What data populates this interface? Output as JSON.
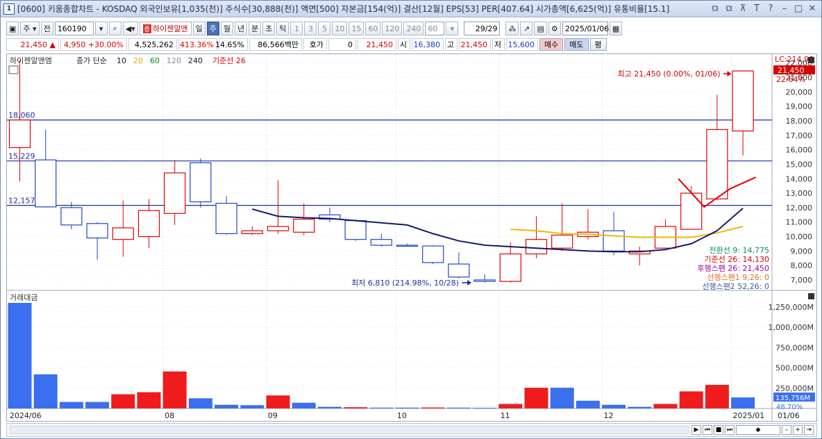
{
  "title": {
    "num": "1",
    "text": "[0600] 키움종합차트 - KOSDAQ 외국인보유[1,035(천)] 주식수[30,888(천)] 액면[500] 자본금[154(억)] 결산[12월] EPS[53] PER[407.64] 시가총액[6,625(억)] 유통비율[15.1]",
    "controls": [
      "⧉",
      "⧉",
      "⊼",
      "T",
      "?",
      "–",
      "□",
      "✕"
    ]
  },
  "toolbar": {
    "mode": "주",
    "mode2": "전",
    "code": "160190",
    "stock_name": "하이젠알앤",
    "periods": [
      "일",
      "주",
      "월",
      "년",
      "분",
      "초",
      "틱"
    ],
    "selected_period": "주",
    "numbers": [
      "1",
      "3",
      "5",
      "10",
      "15",
      "60",
      "120",
      "240",
      "60"
    ],
    "count": "29",
    "count_total": "/29",
    "date": "2025/01/06"
  },
  "quote": {
    "price": "21,450",
    "change": "4,950",
    "change_pct": "+30.00%",
    "volume": "4,525,262",
    "vol_ratio": "413.36%",
    "turnover_pct": "14.65%",
    "amount": "86,566백만",
    "hoga_label": "호가",
    "hoga_val": "0",
    "hoga_price": "21,450",
    "open_label": "시",
    "open": "16,380",
    "high_label": "고",
    "high": "21,450",
    "low_label": "저",
    "low": "15,600",
    "buy": "매수",
    "sell": "매도",
    "eval": "평"
  },
  "price_panel": {
    "stock_label": "하이젠알앤엠",
    "legend_prefix": "종가 단순",
    "ma": [
      {
        "label": "10",
        "color": "#1a1a1a"
      },
      {
        "label": "20",
        "color": "#e0a800"
      },
      {
        "label": "60",
        "color": "#0a8a0a"
      },
      {
        "label": "120",
        "color": "#888888"
      },
      {
        "label": "240",
        "color": "#1a1a1a"
      }
    ],
    "base_line_label": "기준선 26",
    "hlines": [
      {
        "label": "18,060",
        "value": 18060
      },
      {
        "label": "15,229",
        "value": 15229
      },
      {
        "label": "12,157",
        "value": 12157
      }
    ],
    "high_annot": "최고 21,450 (0.00%, 01/06)",
    "low_annot": "최저 6,810 (214.98%, 10/28)",
    "axis_top": "LC:214.98",
    "price_tag": "21,450",
    "pct_tag": "22.64%",
    "ichimoku": [
      {
        "label": "전환선 9: 14,775",
        "color": "#0a8a6a"
      },
      {
        "label": "기준선 26: 14,130",
        "color": "#d80000"
      },
      {
        "label": "후행스팬 26: 21,450",
        "color": "#a000a0"
      },
      {
        "label": "선행스팬1 9,26: 0",
        "color": "#e07020"
      },
      {
        "label": "선행스팬2 52,26: 0",
        "color": "#3a5aa0"
      }
    ]
  },
  "volume_panel": {
    "label": "거래대금",
    "axis": [
      "1,250,000M",
      "1,000,000M",
      "750,000M",
      "500,000M",
      "250,000M"
    ],
    "tag": "135,756M",
    "tag_pct": "48.70%"
  },
  "x_labels": [
    {
      "label": "2024/06",
      "i": 0
    },
    {
      "label": "08",
      "i": 6
    },
    {
      "label": "09",
      "i": 10
    },
    {
      "label": "10",
      "i": 15
    },
    {
      "label": "11",
      "i": 19
    },
    {
      "label": "12",
      "i": 23
    },
    {
      "label": "2025/01",
      "i": 28
    }
  ],
  "x_end_label": "01/06",
  "chart_data": {
    "type": "candlestick",
    "ylim": [
      6000,
      22500
    ],
    "yticks": [
      7000,
      8000,
      9000,
      10000,
      11000,
      12000,
      13000,
      14000,
      15000,
      16000,
      17000,
      18000,
      19000,
      20000,
      21000,
      22000
    ],
    "ytick_labels": [
      "7,000",
      "8,000",
      "9,000",
      "10,000",
      "11,000",
      "12,000",
      "13,000",
      "14,000",
      "15,000",
      "16,000",
      "17,000",
      "18,000",
      "19,000",
      "20,000",
      "21,000",
      "22,000"
    ],
    "candles": [
      {
        "o": 16150,
        "h": 22200,
        "l": 13800,
        "c": 18060
      },
      {
        "o": 15300,
        "h": 17400,
        "l": 12000,
        "c": 12050
      },
      {
        "o": 12000,
        "h": 12400,
        "l": 10500,
        "c": 10800
      },
      {
        "o": 10900,
        "h": 11000,
        "l": 8400,
        "c": 9900
      },
      {
        "o": 9800,
        "h": 12500,
        "l": 8600,
        "c": 10600
      },
      {
        "o": 10000,
        "h": 12600,
        "l": 9200,
        "c": 11800
      },
      {
        "o": 11600,
        "h": 15300,
        "l": 10800,
        "c": 14400
      },
      {
        "o": 15100,
        "h": 15400,
        "l": 12000,
        "c": 12400
      },
      {
        "o": 12300,
        "h": 12800,
        "l": 10100,
        "c": 10200
      },
      {
        "o": 10200,
        "h": 10700,
        "l": 10100,
        "c": 10400
      },
      {
        "o": 10400,
        "h": 13900,
        "l": 10200,
        "c": 10700
      },
      {
        "o": 10300,
        "h": 12300,
        "l": 10100,
        "c": 11200
      },
      {
        "o": 11500,
        "h": 12000,
        "l": 11000,
        "c": 11200
      },
      {
        "o": 11100,
        "h": 11200,
        "l": 9700,
        "c": 9800
      },
      {
        "o": 9800,
        "h": 10200,
        "l": 9300,
        "c": 9400
      },
      {
        "o": 9400,
        "h": 9500,
        "l": 9300,
        "c": 9350
      },
      {
        "o": 9350,
        "h": 9400,
        "l": 8100,
        "c": 8200
      },
      {
        "o": 8100,
        "h": 8900,
        "l": 7100,
        "c": 7200
      },
      {
        "o": 7000,
        "h": 7400,
        "l": 6810,
        "c": 6900
      },
      {
        "o": 6900,
        "h": 9600,
        "l": 6810,
        "c": 8800
      },
      {
        "o": 8800,
        "h": 11400,
        "l": 8500,
        "c": 9800
      },
      {
        "o": 9200,
        "h": 12300,
        "l": 9000,
        "c": 10100
      },
      {
        "o": 10000,
        "h": 11900,
        "l": 9800,
        "c": 10300
      },
      {
        "o": 10400,
        "h": 11700,
        "l": 8700,
        "c": 9000
      },
      {
        "o": 8800,
        "h": 9300,
        "l": 8000,
        "c": 9000
      },
      {
        "o": 9200,
        "h": 11200,
        "l": 9200,
        "c": 10700
      },
      {
        "o": 10500,
        "h": 13500,
        "l": 10500,
        "c": 13000
      },
      {
        "o": 12600,
        "h": 19800,
        "l": 12500,
        "c": 17400
      },
      {
        "o": 17300,
        "h": 21450,
        "l": 15600,
        "c": 21450
      }
    ],
    "ma10": [
      [
        9,
        11900
      ],
      [
        10,
        11400
      ],
      [
        11,
        11300
      ],
      [
        12,
        11250
      ],
      [
        13,
        11100
      ],
      [
        14,
        10950
      ],
      [
        15,
        10800
      ],
      [
        16,
        10200
      ],
      [
        17,
        9700
      ],
      [
        18,
        9400
      ],
      [
        19,
        9300
      ],
      [
        20,
        9200
      ],
      [
        21,
        9100
      ],
      [
        22,
        9000
      ],
      [
        23,
        8950
      ],
      [
        24,
        8950
      ],
      [
        25,
        9100
      ],
      [
        26,
        9500
      ],
      [
        27,
        10400
      ],
      [
        28,
        11950
      ]
    ],
    "ma20": [
      [
        19,
        10500
      ],
      [
        20,
        10400
      ],
      [
        21,
        10200
      ],
      [
        22,
        10150
      ],
      [
        23,
        10050
      ],
      [
        24,
        9950
      ],
      [
        25,
        9950
      ],
      [
        26,
        9950
      ],
      [
        27,
        10250
      ],
      [
        28,
        10700
      ]
    ],
    "kijun": [
      [
        25.5,
        14000
      ],
      [
        26.5,
        12050
      ],
      [
        27.5,
        13300
      ],
      [
        28.5,
        14100
      ]
    ],
    "volume": {
      "ylim": [
        0,
        1300000
      ],
      "bars": [
        {
          "v": 1300000,
          "up": false
        },
        {
          "v": 420000,
          "up": false
        },
        {
          "v": 80000,
          "up": false
        },
        {
          "v": 80000,
          "up": false
        },
        {
          "v": 175000,
          "up": true
        },
        {
          "v": 200000,
          "up": true
        },
        {
          "v": 455000,
          "up": true
        },
        {
          "v": 125000,
          "up": false
        },
        {
          "v": 45000,
          "up": false
        },
        {
          "v": 40000,
          "up": false
        },
        {
          "v": 160000,
          "up": true
        },
        {
          "v": 70000,
          "up": false
        },
        {
          "v": 20000,
          "up": false
        },
        {
          "v": 15000,
          "up": true
        },
        {
          "v": 10000,
          "up": false
        },
        {
          "v": 10000,
          "up": false
        },
        {
          "v": 12000,
          "up": true
        },
        {
          "v": 10000,
          "up": false
        },
        {
          "v": 8000,
          "up": false
        },
        {
          "v": 55000,
          "up": true
        },
        {
          "v": 255000,
          "up": true
        },
        {
          "v": 255000,
          "up": false
        },
        {
          "v": 95000,
          "up": false
        },
        {
          "v": 45000,
          "up": false
        },
        {
          "v": 20000,
          "up": false
        },
        {
          "v": 55000,
          "up": true
        },
        {
          "v": 210000,
          "up": true
        },
        {
          "v": 290000,
          "up": true
        },
        {
          "v": 135756,
          "up": false
        }
      ]
    }
  }
}
